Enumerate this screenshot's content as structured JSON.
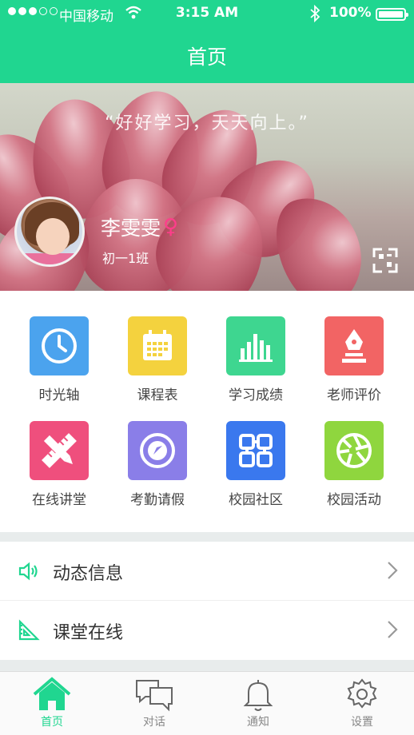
{
  "status": {
    "carrier": "中国移动",
    "time": "3:15 AM",
    "battery": "100%"
  },
  "nav": {
    "title": "首页"
  },
  "banner": {
    "quote": "“好好学习，天天向上。”",
    "name": "李雯雯",
    "gender": "♀",
    "class": "初一1班"
  },
  "grid": [
    {
      "label": "时光轴",
      "color": "#4ba3ee",
      "icon": "clock-icon"
    },
    {
      "label": "课程表",
      "color": "#f4d23e",
      "icon": "calendar-icon"
    },
    {
      "label": "学习成绩",
      "color": "#3ed690",
      "icon": "bar-chart-icon"
    },
    {
      "label": "老师评价",
      "color": "#f26464",
      "icon": "pen-icon"
    },
    {
      "label": "在线讲堂",
      "color": "#ef4f7d",
      "icon": "ruler-pencil-icon"
    },
    {
      "label": "考勤请假",
      "color": "#8a7ee8",
      "icon": "compass-icon"
    },
    {
      "label": "校园社区",
      "color": "#3a78ee",
      "icon": "community-icon"
    },
    {
      "label": "校园活动",
      "color": "#8fd63e",
      "icon": "aperture-icon"
    }
  ],
  "list": [
    {
      "label": "动态信息",
      "icon": "speaker-icon"
    },
    {
      "label": "课堂在线",
      "icon": "ruler-triangle-icon"
    }
  ],
  "tabs": [
    {
      "label": "首页",
      "icon": "home-icon",
      "active": true
    },
    {
      "label": "对话",
      "icon": "chat-icon",
      "active": false
    },
    {
      "label": "通知",
      "icon": "bell-icon",
      "active": false
    },
    {
      "label": "设置",
      "icon": "gear-icon",
      "active": false
    }
  ],
  "colors": {
    "accent": "#20d690",
    "separator": "#e8ecec"
  }
}
